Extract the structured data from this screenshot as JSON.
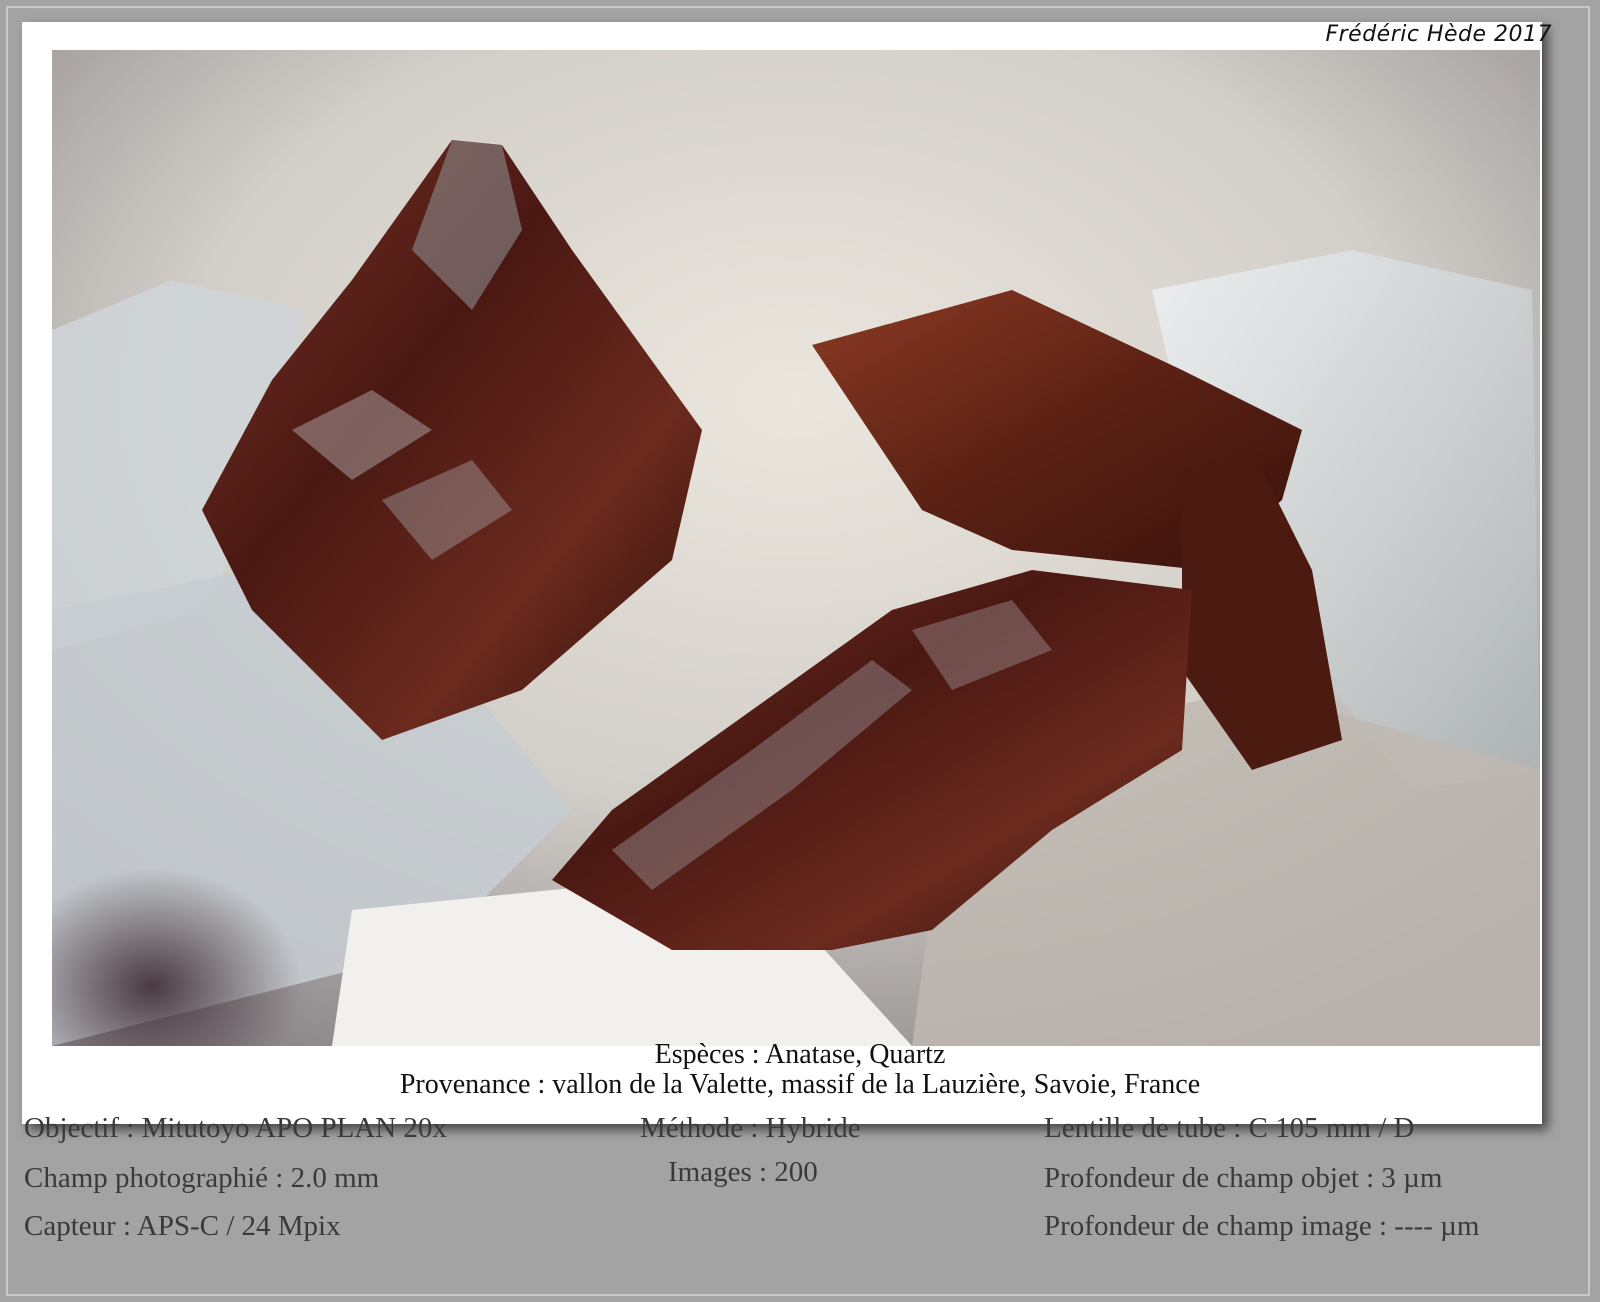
{
  "signature": "Frédéric Hède 2017",
  "caption": {
    "species": "Espèces : Anatase, Quartz",
    "provenance": "Provenance : vallon de la Valette, massif de la Lauzière, Savoie, France"
  },
  "specs": {
    "objective": "Objectif : Mitutoyo APO PLAN 20x",
    "field": "Champ photographié : 2.0 mm",
    "sensor": "Capteur : APS-C / 24 Mpix",
    "method": "Méthode : Hybride",
    "images": "Images : 200",
    "tube_lens": "Lentille de tube : C 105 mm / D",
    "object_dof": "Profondeur de champ objet : 3 µm",
    "image_dof": "Profondeur de champ image : ---- µm"
  },
  "colors": {
    "background": "#a3a3a3",
    "card": "#ffffff",
    "anatase": "#5a1e14",
    "quartz": "#dfe3e6"
  }
}
